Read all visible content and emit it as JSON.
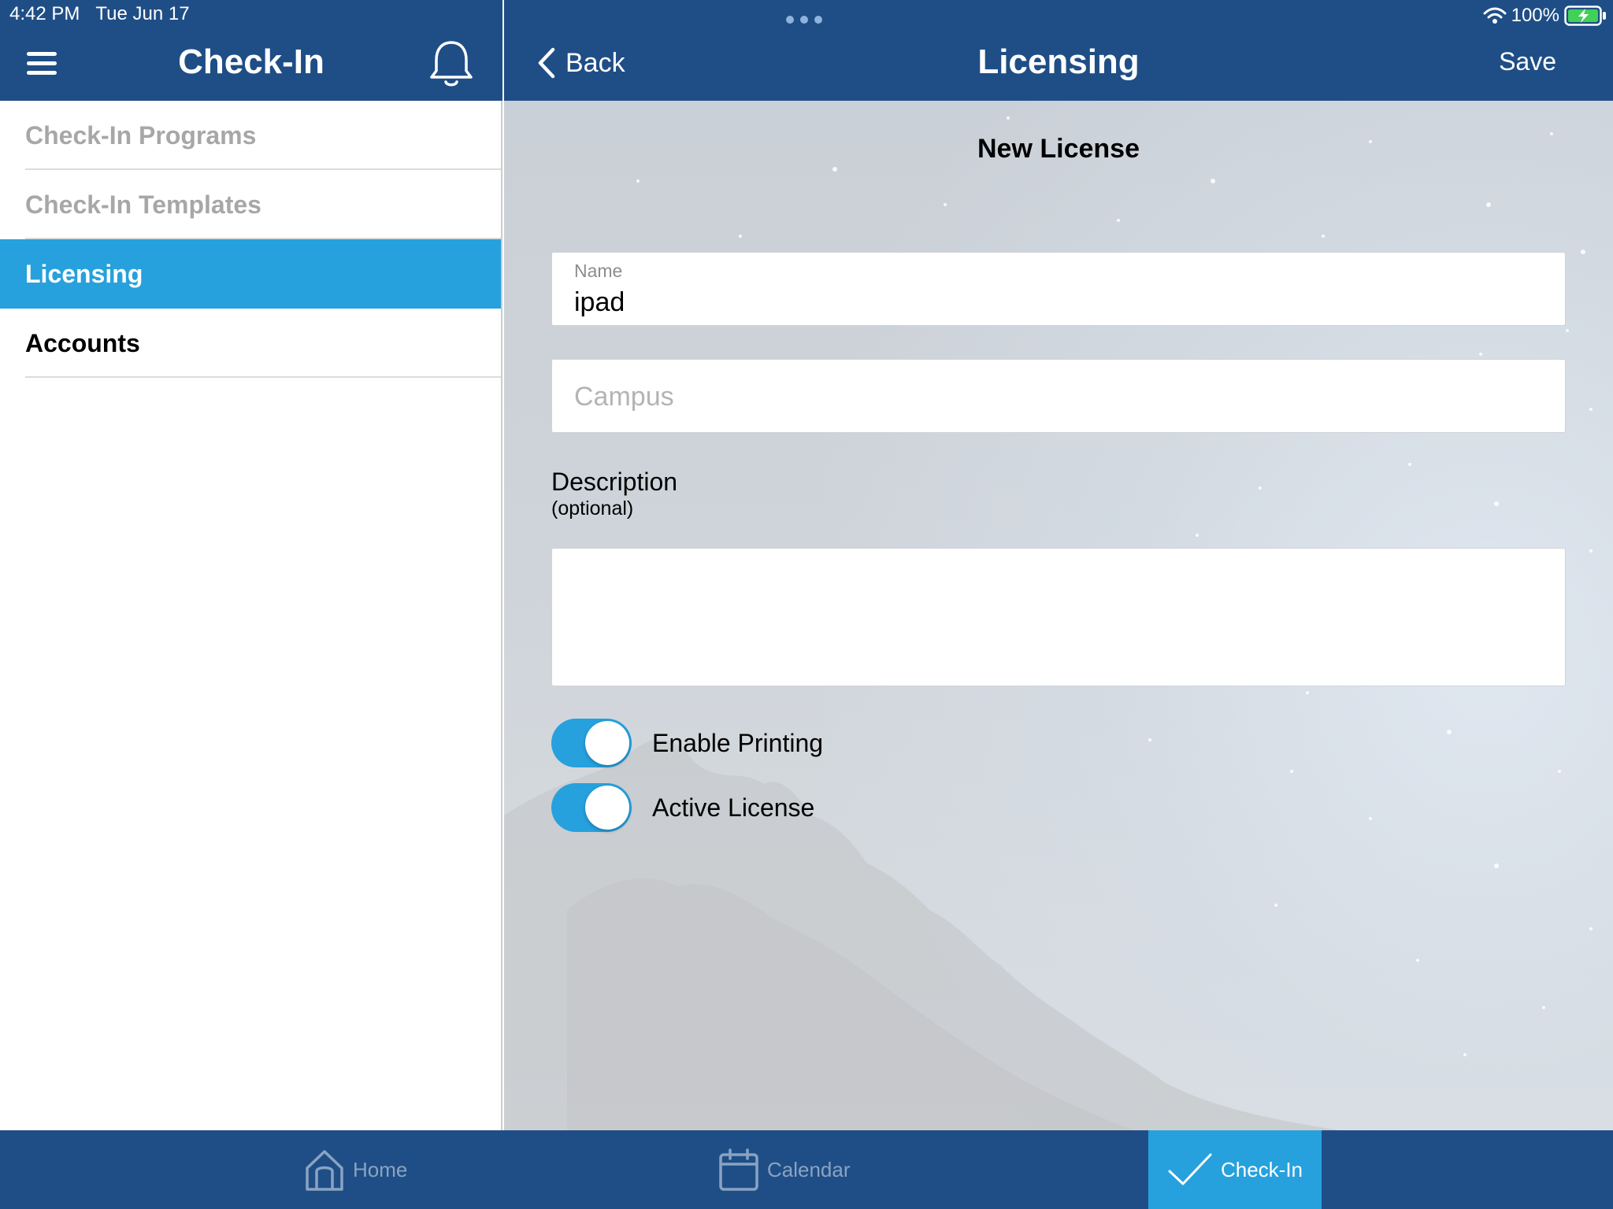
{
  "status_bar": {
    "time": "4:42 PM",
    "date": "Tue Jun 17",
    "battery": "100%"
  },
  "sidebar": {
    "title": "Check-In",
    "items": [
      {
        "label": "Check-In Programs",
        "state": "muted"
      },
      {
        "label": "Check-In Templates",
        "state": "muted"
      },
      {
        "label": "Licensing",
        "state": "selected"
      },
      {
        "label": "Accounts",
        "state": "normal"
      }
    ]
  },
  "detail": {
    "back_label": "Back",
    "title": "Licensing",
    "save_label": "Save",
    "form_title": "New License",
    "name_field": {
      "label": "Name",
      "value": "ipad"
    },
    "campus_field": {
      "placeholder": "Campus"
    },
    "description": {
      "label": "Description",
      "sublabel": "(optional)",
      "value": ""
    },
    "toggles": [
      {
        "label": "Enable Printing",
        "on": true
      },
      {
        "label": "Active License",
        "on": true
      }
    ]
  },
  "tab_bar": {
    "tabs": [
      {
        "label": "Home",
        "icon": "home-icon",
        "selected": false
      },
      {
        "label": "Calendar",
        "icon": "calendar-icon",
        "selected": false
      },
      {
        "label": "Check-In",
        "icon": "checkmark-icon",
        "selected": true
      }
    ]
  },
  "colors": {
    "nav_blue": "#1f4e86",
    "accent_blue": "#26a1dd",
    "muted_text": "#a7a7a7"
  }
}
